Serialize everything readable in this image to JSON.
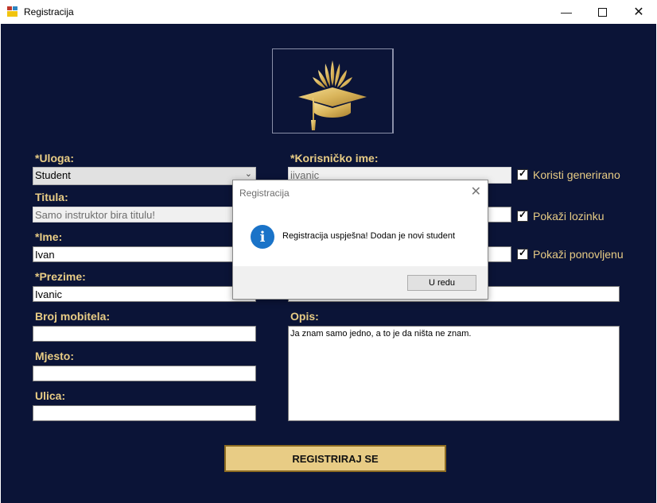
{
  "window": {
    "title": "Registracija"
  },
  "form": {
    "uloga": {
      "label": "*Uloga:",
      "value": "Student"
    },
    "titula": {
      "label": "Titula:",
      "placeholder": "Samo instruktor bira titulu!"
    },
    "ime": {
      "label": "*Ime:",
      "value": "Ivan"
    },
    "prezime": {
      "label": "*Prezime:",
      "value": "Ivanic"
    },
    "mobitel": {
      "label": "Broj mobitela:",
      "value": ""
    },
    "mjesto": {
      "label": "Mjesto:",
      "value": ""
    },
    "ulica": {
      "label": "Ulica:",
      "value": ""
    },
    "korisnicko": {
      "label": "*Korisničko ime:",
      "value": "iivanic"
    },
    "opis": {
      "label": "Opis:",
      "value": "Ja znam samo jedno, a to je da ništa ne znam."
    },
    "checks": {
      "generirano": "Koristi generirano",
      "lozinku": "Pokaži lozinku",
      "ponovljenu": "Pokaži ponovljenu"
    },
    "register_label": "REGISTRIRAJ SE"
  },
  "dialog": {
    "title": "Registracija",
    "message": "Registracija uspješna! Dodan je novi student",
    "ok_label": "U redu"
  },
  "colors": {
    "background": "#0b1437",
    "accent": "#e8cc85",
    "info": "#1a73c8"
  }
}
